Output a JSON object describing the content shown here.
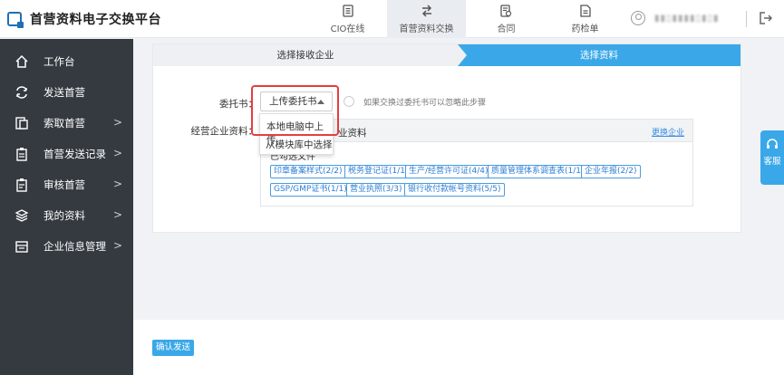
{
  "app": {
    "title": "首营资料电子交换平台"
  },
  "nav": [
    {
      "label": "CIO在线",
      "icon": "document-list-icon",
      "active": false
    },
    {
      "label": "首营资料交换",
      "icon": "swap-arrows-icon",
      "active": true
    },
    {
      "label": "合同",
      "icon": "contract-icon",
      "active": false
    },
    {
      "label": "药检单",
      "icon": "report-icon",
      "active": false
    }
  ],
  "user": {
    "name": "▮▮▯▮▮▮▮▯▮▯▮"
  },
  "sidebar": {
    "items": [
      {
        "label": "工作台",
        "icon": "home-icon",
        "arrow": false
      },
      {
        "label": "发送首营",
        "icon": "send-loop-icon",
        "arrow": false
      },
      {
        "label": "索取首营",
        "icon": "request-doc-icon",
        "arrow": true
      },
      {
        "label": "首营发送记录",
        "icon": "clipboard-icon",
        "arrow": true
      },
      {
        "label": "审核首营",
        "icon": "clipboard-check-icon",
        "arrow": true
      },
      {
        "label": "我的资料",
        "icon": "layers-icon",
        "arrow": true
      },
      {
        "label": "企业信息管理",
        "icon": "building-icon",
        "arrow": true
      }
    ]
  },
  "steps": {
    "step1": "选择接收企业",
    "step2": "选择资料"
  },
  "form": {
    "proxy_label": "委托书：",
    "proxy_select": "上传委托书",
    "proxy_hint": "如果交换过委托书可以忽略此步骤",
    "dropdown_options": [
      "本地电脑中上传",
      "从模块库中选择"
    ],
    "business_label": "经营企业资料："
  },
  "panel": {
    "title": "业资料",
    "change_link": "更换企业",
    "selected_label": "已勾选文件",
    "tags": [
      "印章备案样式(2/2)",
      "税务登记证(1/1)",
      "生产/经营许可证(4/4)",
      "质量管理体系调查表(1/1)",
      "企业年报(2/2)",
      "GSP/GMP证书(1/1)",
      "营业执照(3/3)",
      "银行收付款帐号资料(5/5)"
    ]
  },
  "actions": {
    "confirm": "确认发送"
  },
  "service": {
    "label": "客服"
  },
  "colors": {
    "primary": "#3aa8e8",
    "sidebar": "#343a40",
    "highlight": "#e43e3e",
    "tag": "#2d7ed4"
  }
}
